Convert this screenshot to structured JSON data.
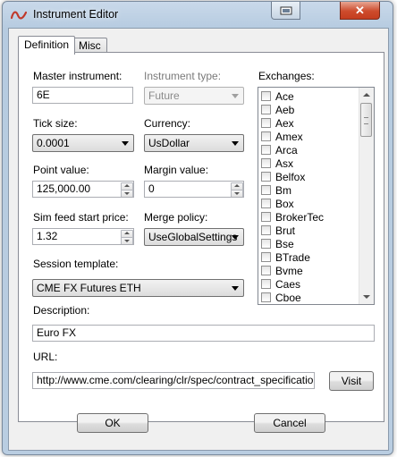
{
  "window": {
    "title": "Instrument Editor"
  },
  "tabs": [
    {
      "label": "Definition",
      "active": true
    },
    {
      "label": "Misc",
      "active": false
    }
  ],
  "form": {
    "master_instrument": {
      "label": "Master instrument:",
      "value": "6E"
    },
    "instrument_type": {
      "label": "Instrument type:",
      "value": "Future",
      "enabled": false
    },
    "tick_size": {
      "label": "Tick size:",
      "value": "0.0001"
    },
    "currency": {
      "label": "Currency:",
      "value": "UsDollar"
    },
    "point_value": {
      "label": "Point value:",
      "value": "125,000.00"
    },
    "margin_value": {
      "label": "Margin value:",
      "value": "0"
    },
    "sim_feed_start_price": {
      "label": "Sim feed start price:",
      "value": "1.32"
    },
    "merge_policy": {
      "label": "Merge policy:",
      "value": "UseGlobalSettings"
    },
    "session_template": {
      "label": "Session template:",
      "value": "CME FX Futures ETH"
    },
    "description": {
      "label": "Description:",
      "value": "Euro FX"
    },
    "url": {
      "label": "URL:",
      "value": "http://www.cme.com/clearing/clr/spec/contract_specifications_a",
      "visit_label": "Visit"
    }
  },
  "exchanges": {
    "label": "Exchanges:",
    "items": [
      "Ace",
      "Aeb",
      "Aex",
      "Amex",
      "Arca",
      "Asx",
      "Belfox",
      "Bm",
      "Box",
      "BrokerTec",
      "Brut",
      "Bse",
      "BTrade",
      "Bvme",
      "Caes",
      "Cboe"
    ]
  },
  "footer": {
    "ok_label": "OK",
    "cancel_label": "Cancel"
  },
  "colors": {
    "close_button": "#c53d1f",
    "frame": "#b9cde1"
  }
}
